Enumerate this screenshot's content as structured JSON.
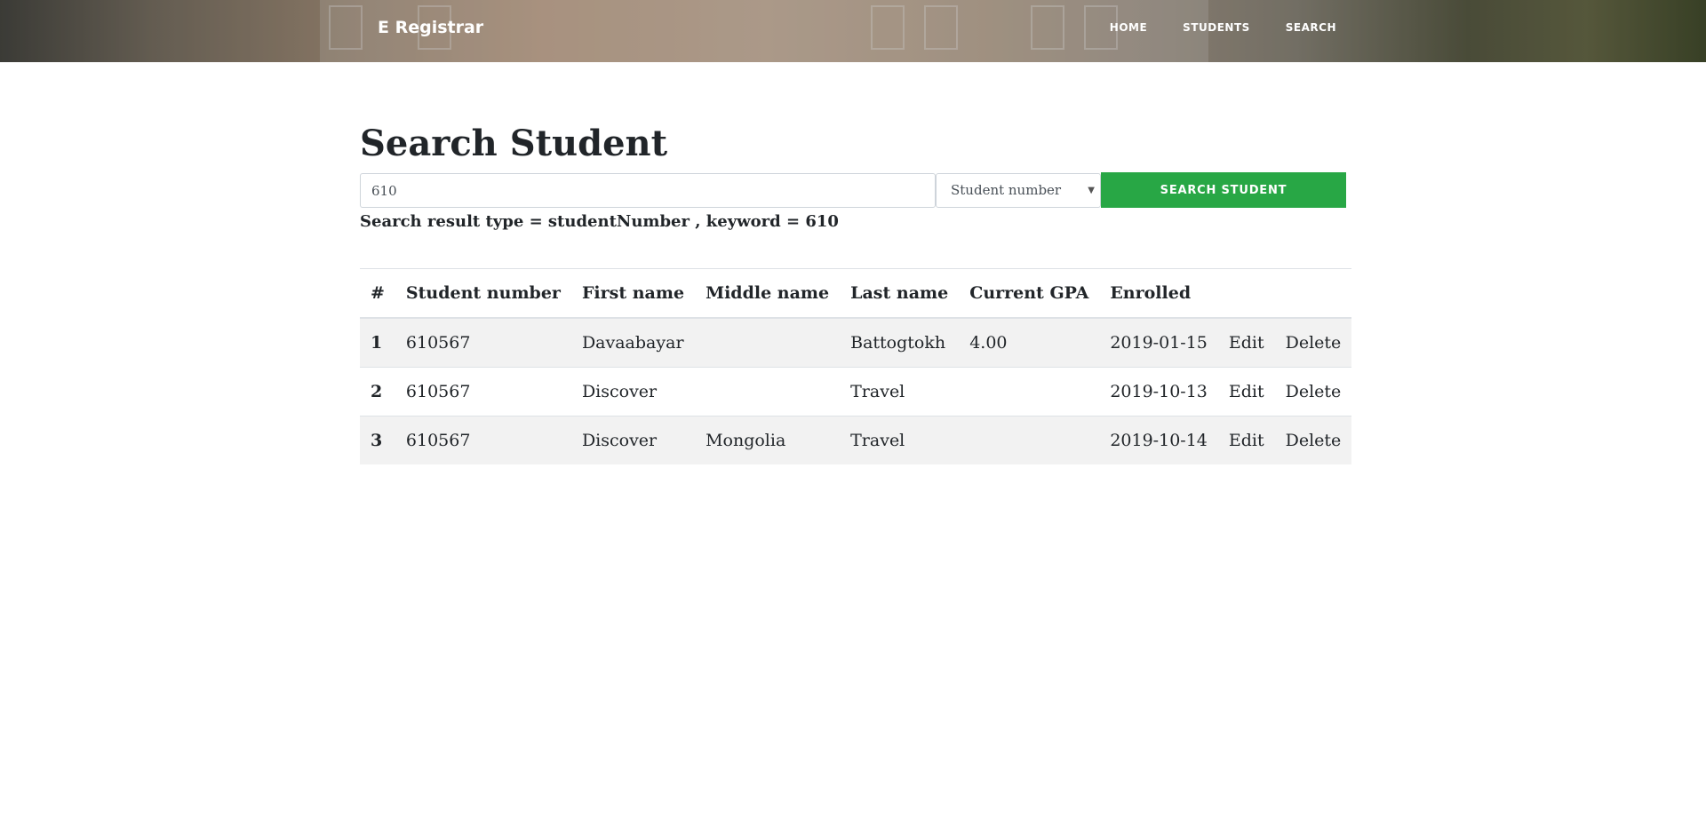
{
  "nav": {
    "brand": "E Registrar",
    "links": [
      "HOME",
      "STUDENTS",
      "SEARCH"
    ]
  },
  "page": {
    "title": "Search Student"
  },
  "search": {
    "value": "610",
    "type_selected": "Student number",
    "button_label": "SEARCH STUDENT",
    "result_text": "Search result type = studentNumber , keyword = 610"
  },
  "table": {
    "headers": [
      "#",
      "Student number",
      "First name",
      "Middle name",
      "Last name",
      "Current GPA",
      "Enrolled"
    ],
    "rows": [
      {
        "idx": "1",
        "student_number": "610567",
        "first": "Davaabayar",
        "middle": "",
        "last": "Battogtokh",
        "gpa": "4.00",
        "enrolled": "2019-01-15",
        "edit": "Edit",
        "delete": "Delete"
      },
      {
        "idx": "2",
        "student_number": "610567",
        "first": "Discover",
        "middle": "",
        "last": "Travel",
        "gpa": "",
        "enrolled": "2019-10-13",
        "edit": "Edit",
        "delete": "Delete"
      },
      {
        "idx": "3",
        "student_number": "610567",
        "first": "Discover",
        "middle": "Mongolia",
        "last": "Travel",
        "gpa": "",
        "enrolled": "2019-10-14",
        "edit": "Edit",
        "delete": "Delete"
      }
    ]
  },
  "colors": {
    "accent": "#28a745",
    "text": "#212529",
    "stripe": "#f2f2f2"
  }
}
